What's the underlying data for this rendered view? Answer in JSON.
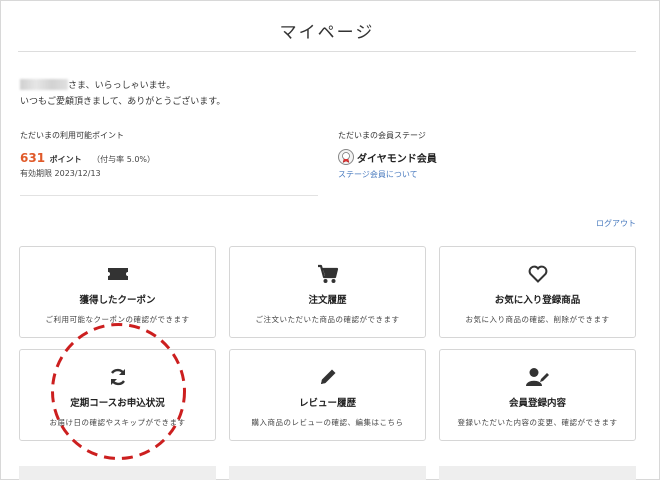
{
  "page": {
    "title": "マイページ"
  },
  "greeting": {
    "line1_suffix": "さま、いらっしゃいませ。",
    "line2": "いつもご愛顧頂きまして、ありがとうございます。"
  },
  "points": {
    "label": "ただいまの利用可能ポイント",
    "value": "631",
    "unit": "ポイント",
    "rate": "（付与率 5.0%）",
    "expiry": "有効期限 2023/12/13"
  },
  "stage": {
    "label": "ただいまの会員ステージ",
    "name": "ダイヤモンド会員",
    "link": "ステージ会員について"
  },
  "logout": "ログアウト",
  "cards": [
    {
      "title": "獲得したクーポン",
      "desc": "ご利用可能なクーポンの確認ができます",
      "icon": "ticket-icon"
    },
    {
      "title": "注文履歴",
      "desc": "ご注文いただいた商品の確認ができます",
      "icon": "cart-icon"
    },
    {
      "title": "お気に入り登録商品",
      "desc": "お気に入り商品の確認、削除ができます",
      "icon": "heart-icon"
    },
    {
      "title": "定期コースお申込状況",
      "desc": "お届け日の確認やスキップができます",
      "icon": "refresh-icon"
    },
    {
      "title": "レビュー履歴",
      "desc": "購入商品のレビューの確認、編集はこちら",
      "icon": "pencil-icon"
    },
    {
      "title": "会員登録内容",
      "desc": "登録いただいた内容の変更、確認ができます",
      "icon": "user-edit-icon"
    }
  ],
  "colors": {
    "points": "#e05a2a",
    "link": "#4a7bbf",
    "annotation": "#cc1f1f"
  }
}
